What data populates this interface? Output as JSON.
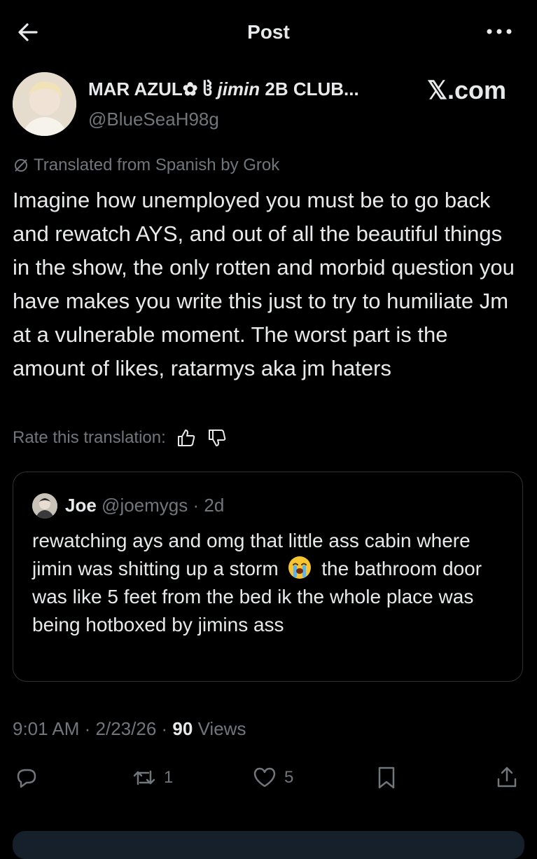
{
  "header": {
    "title": "Post"
  },
  "post": {
    "display_name": "MAR AZUL✿ ⁠(ᐡ˵•ᴗ•˵)⁠ jimin 2B CLUB...",
    "name_part1": "MAR AZUL✿ ",
    "name_part2": "ჱ ",
    "name_part3": "jimin",
    "name_part4": " 2B CLUB...",
    "handle": "@BlueSeaH98g",
    "source": "𝕏.com",
    "translated_label": "Translated from Spanish by Grok",
    "text": "Imagine how unemployed you must be to go back and rewatch AYS, and out of all the beautiful things in the show, the only rotten and morbid question you have makes you write this just to try to humiliate Jm at a vulnerable moment. The worst part is the amount of likes, ratarmys aka jm haters",
    "rate_label": "Rate this translation:",
    "time": "9:01 AM",
    "date": "2/23/26",
    "views_count": "90",
    "views_label": "Views"
  },
  "quote": {
    "name": "Joe",
    "handle": "@joemygs",
    "age": "2d",
    "text_before_emoji": "rewatching ays and omg that little ass cabin where jimin was shitting up a storm",
    "emoji": "😭",
    "text_after_emoji": "the bathroom door was like 5 feet from the bed ik the whole place was being hotboxed by jimins ass"
  },
  "actions": {
    "reposts": "1",
    "likes": "5"
  },
  "icons": {
    "back": "arrow-left-icon",
    "more": "more-horizontal-icon",
    "grok": "grok-slash-icon",
    "thumbs_up": "thumbs-up-icon",
    "thumbs_down": "thumbs-down-icon",
    "reply": "reply-icon",
    "repost": "repost-icon",
    "like": "heart-icon",
    "bookmark": "bookmark-icon",
    "share": "share-icon"
  },
  "colors": {
    "background": "#000000",
    "text": "#e7e9ea",
    "muted": "#71767b",
    "border": "#2f3336"
  }
}
